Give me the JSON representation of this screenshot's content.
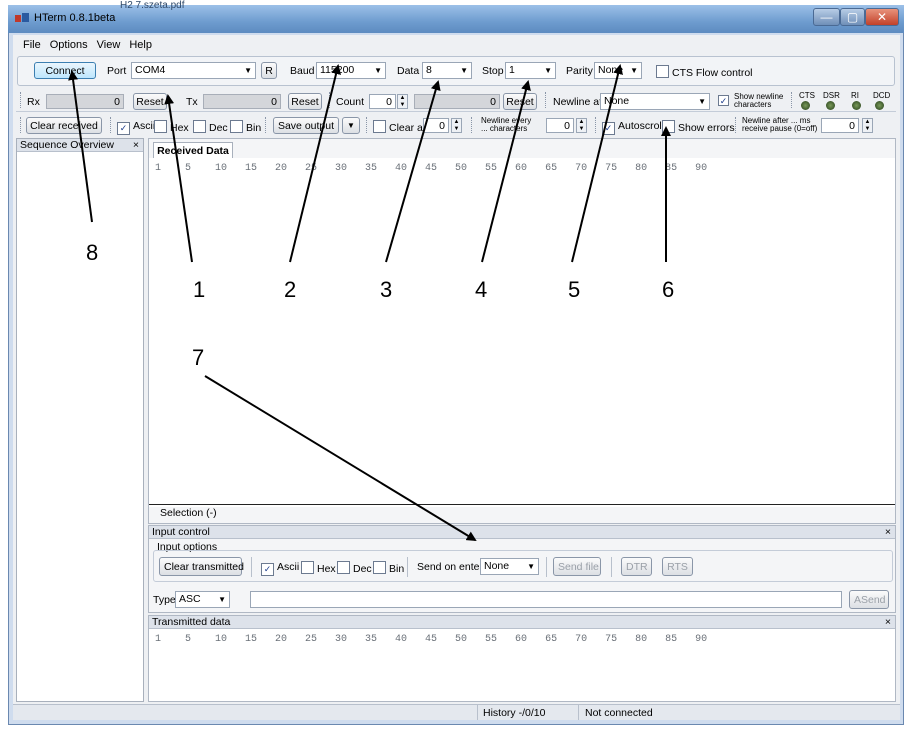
{
  "window": {
    "title": "HTerm 0.8.1beta",
    "behind_title": "H2 7.szeta.pdf"
  },
  "menu": [
    "File",
    "Options",
    "View",
    "Help"
  ],
  "connect": {
    "button": "Connect",
    "port_label": "Port",
    "port_value": "COM4",
    "r_button": "R",
    "baud_label": "Baud",
    "baud_value": "115200",
    "data_label": "Data",
    "data_value": "8",
    "stop_label": "Stop",
    "stop_value": "1",
    "parity_label": "Parity",
    "parity_value": "None",
    "cts_label": "CTS Flow control"
  },
  "counters": {
    "rx_label": "Rx",
    "rx_value": "0",
    "rx_reset": "Reset",
    "tx_label": "Tx",
    "tx_value": "0",
    "tx_reset": "Reset",
    "count_label": "Count",
    "count_value": "0",
    "count_total": "0",
    "count_reset": "Reset",
    "newline_label": "Newline at",
    "newline_value": "None",
    "show_newline": "Show newline characters",
    "leds": [
      "CTS",
      "DSR",
      "RI",
      "DCD"
    ]
  },
  "options": {
    "clear_received": "Clear received",
    "ascii": "Ascii",
    "hex": "Hex",
    "dec": "Dec",
    "bin": "Bin",
    "save_output": "Save output",
    "clear_at": "Clear at",
    "clear_at_value": "0",
    "newline_every": "Newline every ... characters",
    "newline_every_value": "0",
    "autoscroll": "Autoscroll",
    "show_errors": "Show errors",
    "newline_after": "Newline after ... ms receive pause (0=off)",
    "newline_after_value": "0"
  },
  "sidebar": {
    "title": "Sequence Overview",
    "close": "×"
  },
  "received": {
    "tab": "Received Data",
    "ruler": "1    5    10   15   20   25   30   35   40   45   50   55   60   65   70   75   80   85   90",
    "selection": "Selection (-)"
  },
  "input": {
    "title": "Input control",
    "options_label": "Input options",
    "clear_transmitted": "Clear transmitted",
    "ascii": "Ascii",
    "hex": "Hex",
    "dec": "Dec",
    "bin": "Bin",
    "send_on_enter": "Send on enter",
    "send_on_enter_value": "None",
    "send_file": "Send file",
    "dtr": "DTR",
    "rts": "RTS",
    "type_label": "Type",
    "type_value": "ASC",
    "asend": "ASend",
    "close": "×"
  },
  "transmitted": {
    "title": "Transmitted data",
    "close": "×",
    "ruler": "1    5    10   15   20   25   30   35   40   45   50   55   60   65   70   75   80   85   90"
  },
  "status": {
    "history": "History -/0/10",
    "state": "Not connected"
  },
  "callouts": [
    "1",
    "2",
    "3",
    "4",
    "5",
    "6",
    "7",
    "8"
  ]
}
